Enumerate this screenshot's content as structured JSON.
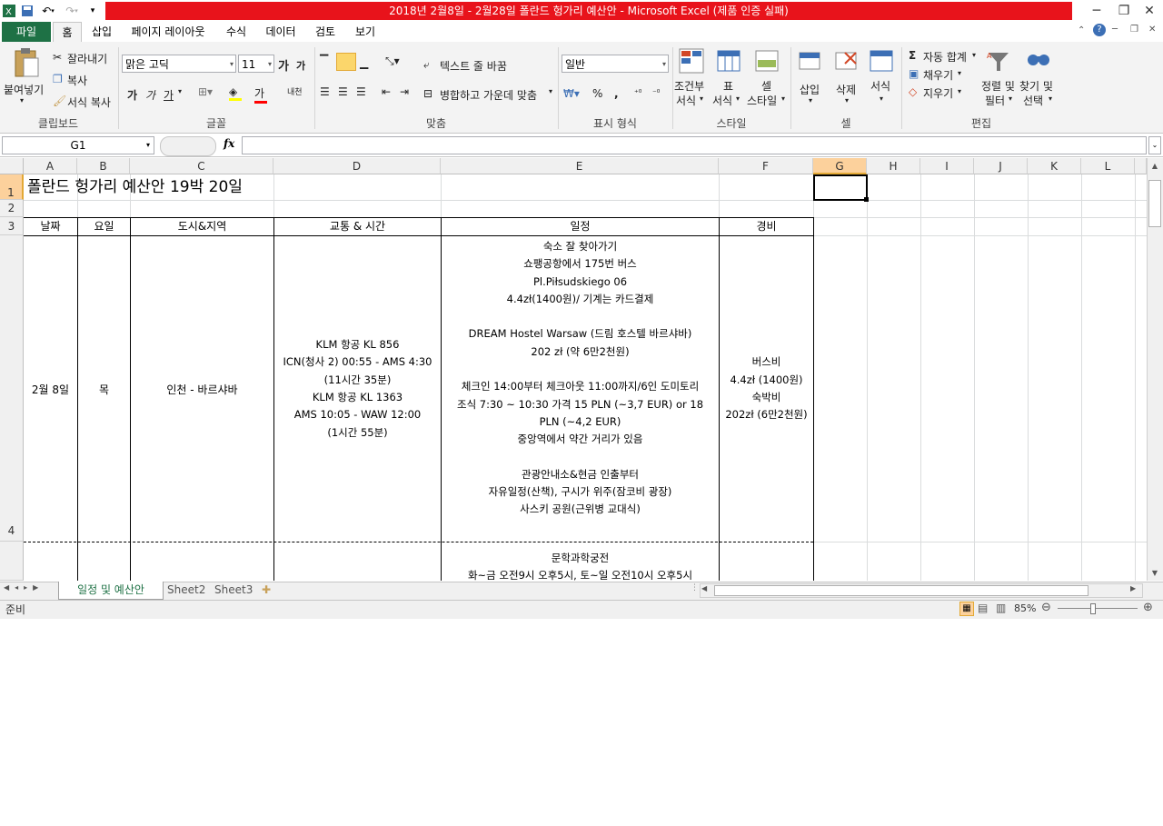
{
  "window": {
    "title": "2018년 2월8일 - 2월28일 폴란드 헝가리 예산안 - Microsoft Excel (제품 인증 실패)",
    "title_bar_color": "#e8131b"
  },
  "menu": {
    "file": "파일",
    "tabs": [
      "홈",
      "삽입",
      "페이지 레이아웃",
      "수식",
      "데이터",
      "검토",
      "보기"
    ]
  },
  "ribbon": {
    "clipboard": {
      "paste": "붙여넣기",
      "cut": "잘라내기",
      "copy": "복사",
      "format_painter": "서식 복사",
      "label": "클립보드"
    },
    "font": {
      "name": "맑은 고딕",
      "size": "11",
      "label": "글꼴",
      "grow": "가",
      "shrink": "가",
      "bold": "가",
      "italic": "가",
      "underline": "가",
      "font_color": "가",
      "phonetic": "내천"
    },
    "alignment": {
      "wrap": "텍스트 줄 바꿈",
      "merge": "병합하고 가운데 맞춤",
      "label": "맞춤"
    },
    "number": {
      "format": "일반",
      "percent": "%",
      "comma": ",",
      "label": "표시 형식"
    },
    "styles": {
      "conditional": "조건부",
      "conditional2": "서식",
      "table": "표",
      "table2": "서식",
      "cell": "셀",
      "cell2": "스타일",
      "label": "스타일"
    },
    "cells": {
      "insert": "삽입",
      "delete": "삭제",
      "format": "서식",
      "label": "셀"
    },
    "editing": {
      "autosum": "자동 합계",
      "fill": "채우기",
      "clear": "지우기",
      "sort": "정렬 및",
      "sort2": "필터",
      "find": "찾기 및",
      "find2": "선택",
      "label": "편집"
    }
  },
  "formula_bar": {
    "name_box": "G1",
    "fx": "fx",
    "value": ""
  },
  "columns": [
    "A",
    "B",
    "C",
    "D",
    "E",
    "F",
    "G",
    "H",
    "I",
    "J",
    "K",
    "L"
  ],
  "rows": [
    "1",
    "2",
    "3",
    "4"
  ],
  "sheet": {
    "title": "폴란드 헝가리 예산안 19박 20일",
    "headers": {
      "date": "날짜",
      "day": "요일",
      "city": "도시&지역",
      "transport": "교통 & 시간",
      "schedule": "일정",
      "cost": "경비"
    },
    "row4": {
      "date": "2월 8일",
      "day": "목",
      "city": "인천 - 바르샤바",
      "transport": "KLM 항공 KL 856\nICN(청사 2) 00:55 - AMS 4:30\n(11시간 35분)\nKLM 항공 KL 1363\nAMS 10:05 - WAW 12:00\n(1시간 55분)",
      "schedule": "숙소 잘 찾아가기\n쇼팽공항에서 175번 버스\nPl.Piłsudskiego 06\n4.4zł(1400원)/ 기계는 카드결제\n\nDREAM Hostel Warsaw (드림 호스텔 바르샤바)\n202 zł (약 6만2천원)\n\n체크인 14:00부터 체크아웃 11:00까지/6인 도미토리\n조식 7:30 ~ 10:30 가격 15 PLN (~3,7 EUR) or 18\nPLN (~4,2 EUR)\n중앙역에서 약간 거리가 있음\n\n관광안내소&현금 인출부터\n자유일정(산책), 구시가 위주(잠코비 광장)\n사스키 공원(근위병 교대식)",
      "cost": "버스비\n4.4zł (1400원)\n숙박비\n202zł (6만2천원)"
    },
    "row5": {
      "schedule": "문학과학궁전\n화~금 오전9시 오후5시, 토~일 오전10시 오후5시"
    }
  },
  "sheet_tabs": [
    "일정 및 예산안",
    "Sheet2",
    "Sheet3"
  ],
  "status": {
    "ready": "준비",
    "zoom": "85%"
  }
}
